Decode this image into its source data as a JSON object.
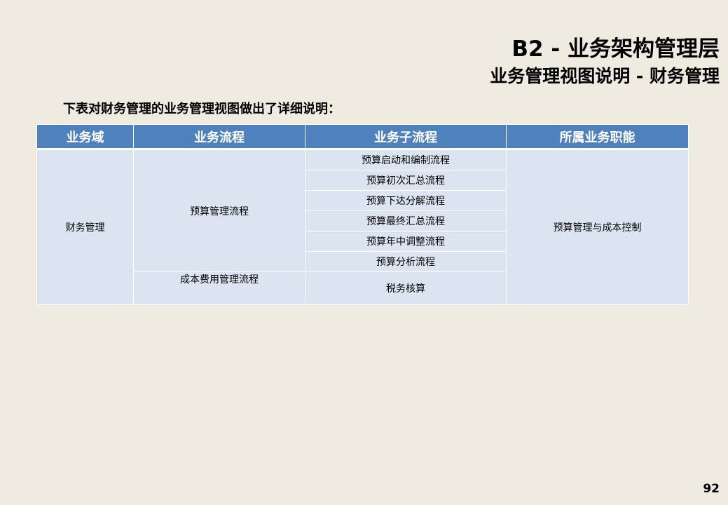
{
  "header": {
    "title": "B2 - 业务架构管理层",
    "subtitle": "业务管理视图说明 - 财务管理"
  },
  "intro": "下表对财务管理的业务管理视图做出了详细说明：",
  "table": {
    "columns": [
      "业务域",
      "业务流程",
      "业务子流程",
      "所属业务职能"
    ],
    "domain": "财务管理",
    "function": "预算管理与成本控制",
    "processes": [
      {
        "name": "预算管理流程",
        "subprocesses": [
          "预算启动和编制流程",
          "预算初次汇总流程",
          "预算下达分解流程",
          "预算最终汇总流程",
          "预算年中调整流程",
          "预算分析流程"
        ]
      },
      {
        "name": "成本费用管理流程",
        "subprocesses": [
          "税务核算"
        ]
      }
    ]
  },
  "footer": {
    "page_number": "92"
  }
}
